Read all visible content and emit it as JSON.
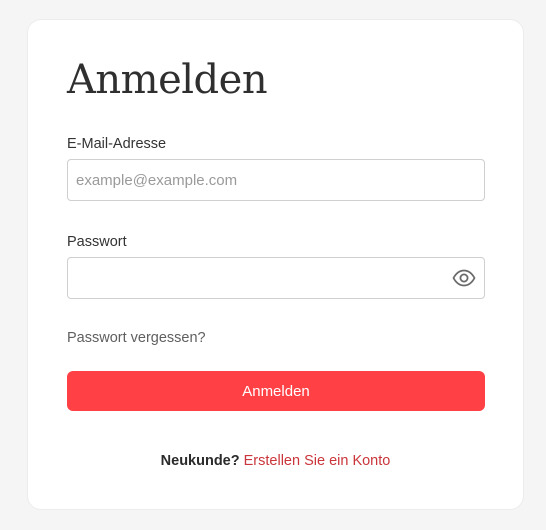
{
  "login": {
    "title": "Anmelden",
    "email_label": "E-Mail-Adresse",
    "email_placeholder": "example@example.com",
    "email_value": "",
    "password_label": "Passwort",
    "password_placeholder": "",
    "password_value": "",
    "forgot_link": "Passwort vergessen?",
    "submit_label": "Anmelden",
    "signup_question": "Neukunde?",
    "signup_link": "Erstellen Sie ein Konto"
  },
  "icons": {
    "password_toggle": "eye-icon"
  },
  "colors": {
    "background": "#f5f5f5",
    "card": "#ffffff",
    "button": "#ff4045",
    "link_accent": "#c9353b"
  }
}
